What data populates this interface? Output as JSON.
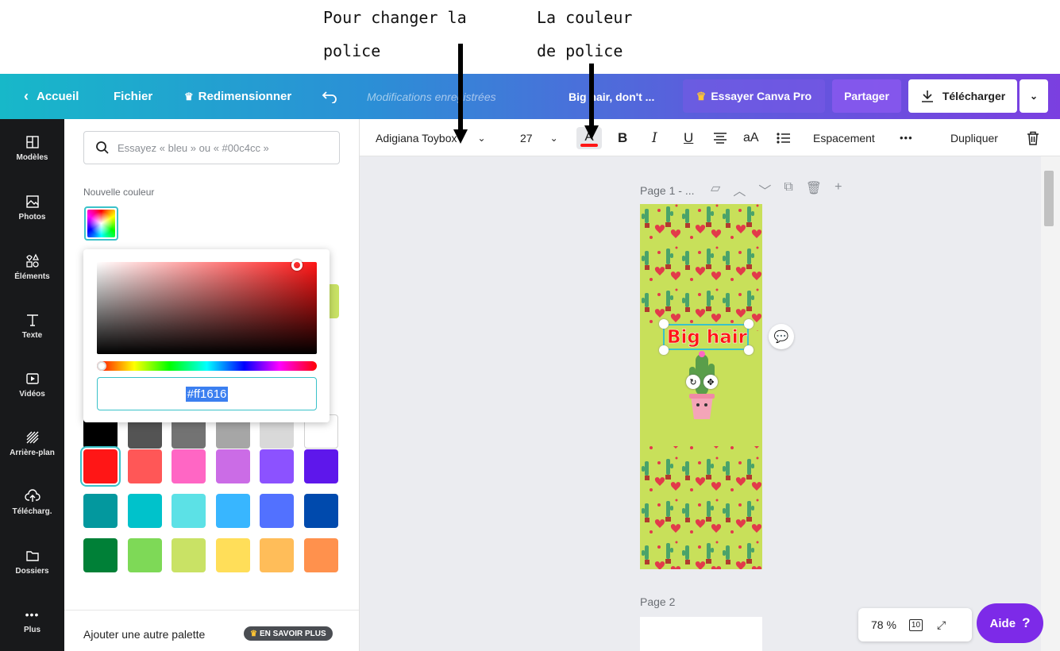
{
  "annotations": {
    "font_change_line1": "Pour changer la",
    "font_change_line2": "police",
    "font_color_line1": "La couleur",
    "font_color_line2": "de police"
  },
  "topbar": {
    "home": "Accueil",
    "file": "Fichier",
    "resize": "Redimensionner",
    "status": "Modifications enregistrées",
    "doc_title": "Big hair, don't ...",
    "try_pro": "Essayer Canva Pro",
    "share": "Partager",
    "download": "Télécharger"
  },
  "rail": [
    {
      "label": "Modèles",
      "icon": "templates-icon"
    },
    {
      "label": "Photos",
      "icon": "photos-icon"
    },
    {
      "label": "Éléments",
      "icon": "elements-icon"
    },
    {
      "label": "Texte",
      "icon": "text-icon"
    },
    {
      "label": "Vidéos",
      "icon": "videos-icon"
    },
    {
      "label": "Arrière-plan",
      "icon": "background-icon"
    },
    {
      "label": "Télécharg.",
      "icon": "upload-icon"
    },
    {
      "label": "Dossiers",
      "icon": "folder-icon"
    },
    {
      "label": "Plus",
      "icon": "more-icon"
    }
  ],
  "panel": {
    "search_placeholder": "Essayez « bleu » ou « #00c4cc »",
    "new_color_label": "Nouvelle couleur",
    "hex_value": "#ff1616",
    "add_palette": "Ajouter une autre palette",
    "learn_more": "EN SAVOIR PLUS",
    "swatches": [
      [
        "#000000",
        "#545454",
        "#737373",
        "#a6a6a6",
        "#d9d9d9",
        "#ffffff"
      ],
      [
        "#ff1616",
        "#ff5757",
        "#ff66c4",
        "#cb6ce6",
        "#8c52ff",
        "#5e17eb"
      ],
      [
        "#03989e",
        "#00c2cb",
        "#5ce1e6",
        "#38b6ff",
        "#5271ff",
        "#004aad"
      ],
      [
        "#008037",
        "#7ed957",
        "#c9e265",
        "#ffde59",
        "#ffbd59",
        "#ff914d"
      ]
    ],
    "selected_swatch": "#ff1616"
  },
  "toolbar": {
    "font_name": "Adigiana Toybox",
    "font_size": "27",
    "bold": "B",
    "italic": "I",
    "underline": "U",
    "case": "aA",
    "spacing": "Espacement",
    "more": "•••",
    "duplicate": "Dupliquer",
    "text_color": "#ff1616"
  },
  "canvas": {
    "page1_label": "Page 1 - ...",
    "page2_label": "Page 2",
    "text_element": "Big hair",
    "page_background": "#c8e05a"
  },
  "bottom": {
    "zoom": "78 %",
    "page_count": "10",
    "help": "Aide",
    "help_mark": "?"
  }
}
